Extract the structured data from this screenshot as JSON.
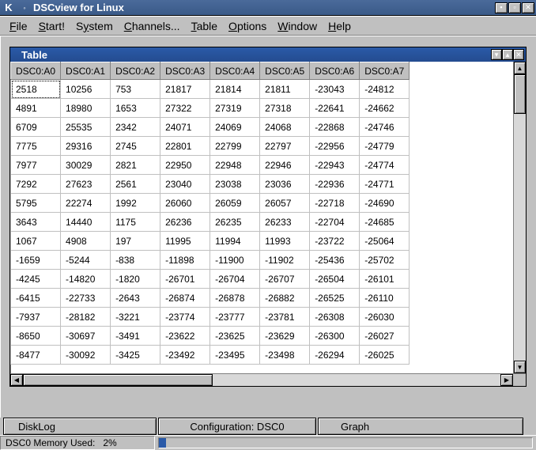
{
  "window": {
    "app_icon_label": "K",
    "title": "DSCview for Linux"
  },
  "menu": {
    "file": {
      "label": "File",
      "ul": "F",
      "rest": "ile"
    },
    "start": {
      "label": "Start!",
      "ul": "S",
      "rest": "tart!"
    },
    "system": {
      "label": "System",
      "pre": "S",
      "ul": "y",
      "rest": "stem"
    },
    "channels": {
      "label": "Channels...",
      "ul": "C",
      "rest": "hannels..."
    },
    "table": {
      "label": "Table",
      "ul": "T",
      "rest": "able"
    },
    "options": {
      "label": "Options",
      "ul": "O",
      "rest": "ptions"
    },
    "window": {
      "label": "Window",
      "ul": "W",
      "rest": "indow"
    },
    "help": {
      "label": "Help",
      "ul": "H",
      "rest": "elp"
    }
  },
  "subwindow": {
    "title": "Table"
  },
  "table": {
    "headers": [
      "DSC0:A0",
      "DSC0:A1",
      "DSC0:A2",
      "DSC0:A3",
      "DSC0:A4",
      "DSC0:A5",
      "DSC0:A6",
      "DSC0:A7"
    ],
    "rows": [
      [
        "2518",
        "10256",
        "753",
        "21817",
        "21814",
        "21811",
        "-23043",
        "-24812"
      ],
      [
        "4891",
        "18980",
        "1653",
        "27322",
        "27319",
        "27318",
        "-22641",
        "-24662"
      ],
      [
        "6709",
        "25535",
        "2342",
        "24071",
        "24069",
        "24068",
        "-22868",
        "-24746"
      ],
      [
        "7775",
        "29316",
        "2745",
        "22801",
        "22799",
        "22797",
        "-22956",
        "-24779"
      ],
      [
        "7977",
        "30029",
        "2821",
        "22950",
        "22948",
        "22946",
        "-22943",
        "-24774"
      ],
      [
        "7292",
        "27623",
        "2561",
        "23040",
        "23038",
        "23036",
        "-22936",
        "-24771"
      ],
      [
        "5795",
        "22274",
        "1992",
        "26060",
        "26059",
        "26057",
        "-22718",
        "-24690"
      ],
      [
        "3643",
        "14440",
        "1175",
        "26236",
        "26235",
        "26233",
        "-22704",
        "-24685"
      ],
      [
        "1067",
        "4908",
        "197",
        "11995",
        "11994",
        "11993",
        "-23722",
        "-25064"
      ],
      [
        "-1659",
        "-5244",
        "-838",
        "-11898",
        "-11900",
        "-11902",
        "-25436",
        "-25702"
      ],
      [
        "-4245",
        "-14820",
        "-1820",
        "-26701",
        "-26704",
        "-26707",
        "-26504",
        "-26101"
      ],
      [
        "-6415",
        "-22733",
        "-2643",
        "-26874",
        "-26878",
        "-26882",
        "-26525",
        "-26110"
      ],
      [
        "-7937",
        "-28182",
        "-3221",
        "-23774",
        "-23777",
        "-23781",
        "-26308",
        "-26030"
      ],
      [
        "-8650",
        "-30697",
        "-3491",
        "-23622",
        "-23625",
        "-23629",
        "-26300",
        "-26027"
      ],
      [
        "-8477",
        "-30092",
        "-3425",
        "-23492",
        "-23495",
        "-23498",
        "-26294",
        "-26025"
      ]
    ]
  },
  "tabs": {
    "disklog": "DiskLog",
    "config": "Configuration: DSC0",
    "graph": "Graph"
  },
  "status": {
    "label": "DSC0 Memory Used:",
    "value": "2%",
    "percent": 2
  },
  "chart_data": {
    "type": "table",
    "title": "Table",
    "columns": [
      "DSC0:A0",
      "DSC0:A1",
      "DSC0:A2",
      "DSC0:A3",
      "DSC0:A4",
      "DSC0:A5",
      "DSC0:A6",
      "DSC0:A7"
    ],
    "data": [
      [
        2518,
        10256,
        753,
        21817,
        21814,
        21811,
        -23043,
        -24812
      ],
      [
        4891,
        18980,
        1653,
        27322,
        27319,
        27318,
        -22641,
        -24662
      ],
      [
        6709,
        25535,
        2342,
        24071,
        24069,
        24068,
        -22868,
        -24746
      ],
      [
        7775,
        29316,
        2745,
        22801,
        22799,
        22797,
        -22956,
        -24779
      ],
      [
        7977,
        30029,
        2821,
        22950,
        22948,
        22946,
        -22943,
        -24774
      ],
      [
        7292,
        27623,
        2561,
        23040,
        23038,
        23036,
        -22936,
        -24771
      ],
      [
        5795,
        22274,
        1992,
        26060,
        26059,
        26057,
        -22718,
        -24690
      ],
      [
        3643,
        14440,
        1175,
        26236,
        26235,
        26233,
        -22704,
        -24685
      ],
      [
        1067,
        4908,
        197,
        11995,
        11994,
        11993,
        -23722,
        -25064
      ],
      [
        -1659,
        -5244,
        -838,
        -11898,
        -11900,
        -11902,
        -25436,
        -25702
      ],
      [
        -4245,
        -14820,
        -1820,
        -26701,
        -26704,
        -26707,
        -26504,
        -26101
      ],
      [
        -6415,
        -22733,
        -2643,
        -26874,
        -26878,
        -26882,
        -26525,
        -26110
      ],
      [
        -7937,
        -28182,
        -3221,
        -23774,
        -23777,
        -23781,
        -26308,
        -26030
      ],
      [
        -8650,
        -30697,
        -3491,
        -23622,
        -23625,
        -23629,
        -26300,
        -26027
      ],
      [
        -8477,
        -30092,
        -3425,
        -23492,
        -23495,
        -23498,
        -26294,
        -26025
      ]
    ]
  }
}
